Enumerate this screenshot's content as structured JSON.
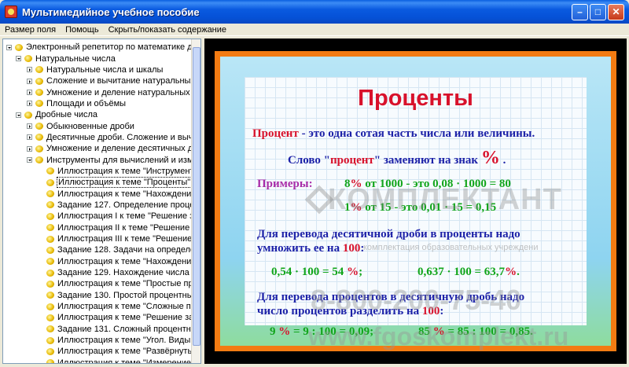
{
  "window": {
    "title": "Мультимедийное учебное пособие"
  },
  "menu": [
    "Размер поля",
    "Помощь",
    "Скрыть/показать содержание"
  ],
  "tree": [
    {
      "label": "Электронный репетитор по математике дл",
      "level": 0,
      "expander": "open"
    },
    {
      "label": "Натуральные числа",
      "level": 1,
      "expander": "open"
    },
    {
      "label": "Натуральные числа и шкалы",
      "level": 2,
      "expander": "closed"
    },
    {
      "label": "Сложение и вычитание натуральных ч",
      "level": 2,
      "expander": "closed"
    },
    {
      "label": "Умножение и деление натуральных чи",
      "level": 2,
      "expander": "closed"
    },
    {
      "label": "Площади и объёмы",
      "level": 2,
      "expander": "closed"
    },
    {
      "label": "Дробные числа",
      "level": 1,
      "expander": "open"
    },
    {
      "label": "Обыкновенные дроби",
      "level": 2,
      "expander": "closed"
    },
    {
      "label": "Десятичные дроби. Сложение и вычи",
      "level": 2,
      "expander": "closed"
    },
    {
      "label": "Умножение и деление десятичных др",
      "level": 2,
      "expander": "closed"
    },
    {
      "label": "Инструменты для вычислений и изме",
      "level": 2,
      "expander": "open"
    },
    {
      "label": "Иллюстрация к теме \"Инструменть",
      "level": 3,
      "expander": "none"
    },
    {
      "label": "Иллюстрация к теме \"Проценты\"",
      "level": 3,
      "expander": "none",
      "selected": true
    },
    {
      "label": "Иллюстрация к теме \"Нахождение",
      "level": 3,
      "expander": "none"
    },
    {
      "label": "Задание 127. Определение процен",
      "level": 3,
      "expander": "none"
    },
    {
      "label": "Иллюстрация I к теме \"Решение за",
      "level": 3,
      "expander": "none"
    },
    {
      "label": "Иллюстрация II к теме \"Решение з",
      "level": 3,
      "expander": "none"
    },
    {
      "label": "Иллюстрация III к теме \"Решение з",
      "level": 3,
      "expander": "none"
    },
    {
      "label": "Задание 128. Задачи на определе",
      "level": 3,
      "expander": "none"
    },
    {
      "label": "Иллюстрация к теме \"Нахождение",
      "level": 3,
      "expander": "none"
    },
    {
      "label": "Задание 129. Нахождение числа п",
      "level": 3,
      "expander": "none"
    },
    {
      "label": "Иллюстрация к теме \"Простые про",
      "level": 3,
      "expander": "none"
    },
    {
      "label": "Задание 130. Простой процентный",
      "level": 3,
      "expander": "none"
    },
    {
      "label": "Иллюстрация к теме \"Сложные про",
      "level": 3,
      "expander": "none"
    },
    {
      "label": "Иллюстрация к теме \"Решение зад",
      "level": 3,
      "expander": "none"
    },
    {
      "label": "Задание 131. Сложный процентны",
      "level": 3,
      "expander": "none"
    },
    {
      "label": "Иллюстрация к теме \"Угол. Виды у",
      "level": 3,
      "expander": "none"
    },
    {
      "label": "Иллюстрация к теме \"Развёрнутый",
      "level": 3,
      "expander": "none"
    },
    {
      "label": "Иллюстрация к теме \"Измерение у",
      "level": 3,
      "expander": "none"
    }
  ],
  "slide": {
    "title": "Проценты",
    "def_term": "Процент",
    "def_rest": " - это одна сотая часть числа или величины.",
    "word_pre": "Слово \"",
    "word_term": "процент",
    "word_post": "\" заменяют на знак ",
    "word_sign": "%",
    "word_end": " .",
    "examples_label": "Примеры:",
    "ex1_a": "8",
    "ex1_pct": "%",
    "ex1_b": " от 1000 - это 0,08 · 1000 = 80",
    "ex2_a": "1",
    "ex2_pct": "%",
    "ex2_b": " от 15 - это 0,01 · 15 = 0,15",
    "rule1_line1": "Для перевода десятичной дроби в проценты надо",
    "rule1_line2_pre": "умножить ее на ",
    "rule1_num": "100",
    "rule1_colon": ":",
    "r1a": "0,54 · 100 = 54 ",
    "r1a_pct": "%",
    "r1a_end": ";",
    "r1b": "0,637 · 100 = 63,7",
    "r1b_pct": "%",
    "r1b_end": ".",
    "rule2_line1": "Для перевода процентов в десятичную дробь надо",
    "rule2_line2_pre": "число процентов разделить на ",
    "rule2_num": "100",
    "rule2_colon": ":",
    "r2a_pre": "9 ",
    "r2a_pct": "%",
    "r2a_post": " = 9 : 100 = 0,09;",
    "r2b_pre": "85 ",
    "r2b_pct": "%",
    "r2b_post": " = 85 : 100 = 0,85."
  },
  "watermark": {
    "brand": "КОМПЛЕКТАНТ",
    "tagline": "комплектация образовательных учреждени",
    "phone": "8-800-200-75-40",
    "site": "www.fgoskomplekt.ru"
  }
}
